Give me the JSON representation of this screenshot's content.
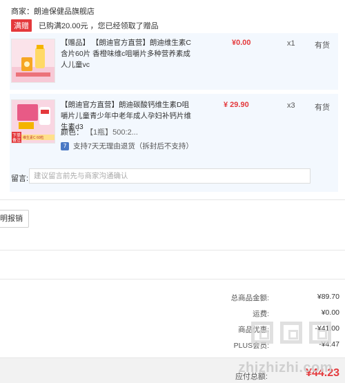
{
  "shop": {
    "label": "商家：朗迪保健品旗舰店"
  },
  "promo": {
    "tag": "满赠",
    "text": "已购满20.00元 ，您已经领取了赠品"
  },
  "items": [
    {
      "title": "【赠品】 【朗迪官方直营】朗迪维生素C含片60片 香橙味维c咀嚼片多种营养素成人儿童vc",
      "price": "¥0.00",
      "qty": "x1",
      "stock": "有货"
    },
    {
      "title": "【朗迪官方直营】朗迪碳酸钙维生素D咀嚼片儿童青少年中老年成人孕妇补钙片维生素d3",
      "price": "¥ 29.90",
      "qty": "x3",
      "stock": "有货",
      "spec_label": "颜色：",
      "spec_value": "【1瓶】500:2...",
      "return_icon": "7",
      "return_text": "支持7天无理由退货（拆封后不支持）",
      "thumb_badge": "下单备注",
      "thumb_text": "维生素C 60粒"
    }
  ],
  "message": {
    "label": "留言:",
    "placeholder": "建议留言前先与商家沟通确认"
  },
  "invoice": {
    "label": "明报销"
  },
  "summary": {
    "rows": [
      {
        "label": "总商品金额:",
        "value": "¥89.70"
      },
      {
        "label": "运费:",
        "value": "¥0.00"
      },
      {
        "label": "商品优惠:",
        "value": "-¥41.00"
      },
      {
        "label": "PLUS会员:",
        "value": "-¥4.47"
      }
    ],
    "pay_label": "应付总额:",
    "pay_value": "¥44.23"
  },
  "watermark": {
    "text": "zhizhizhi.com"
  },
  "colors": {
    "accent": "#e4393c",
    "panel": "#f3f8fe",
    "link": "#4a78c4"
  },
  "icons": {
    "return": "seven-day-return-icon",
    "promo": "gift-tag"
  }
}
